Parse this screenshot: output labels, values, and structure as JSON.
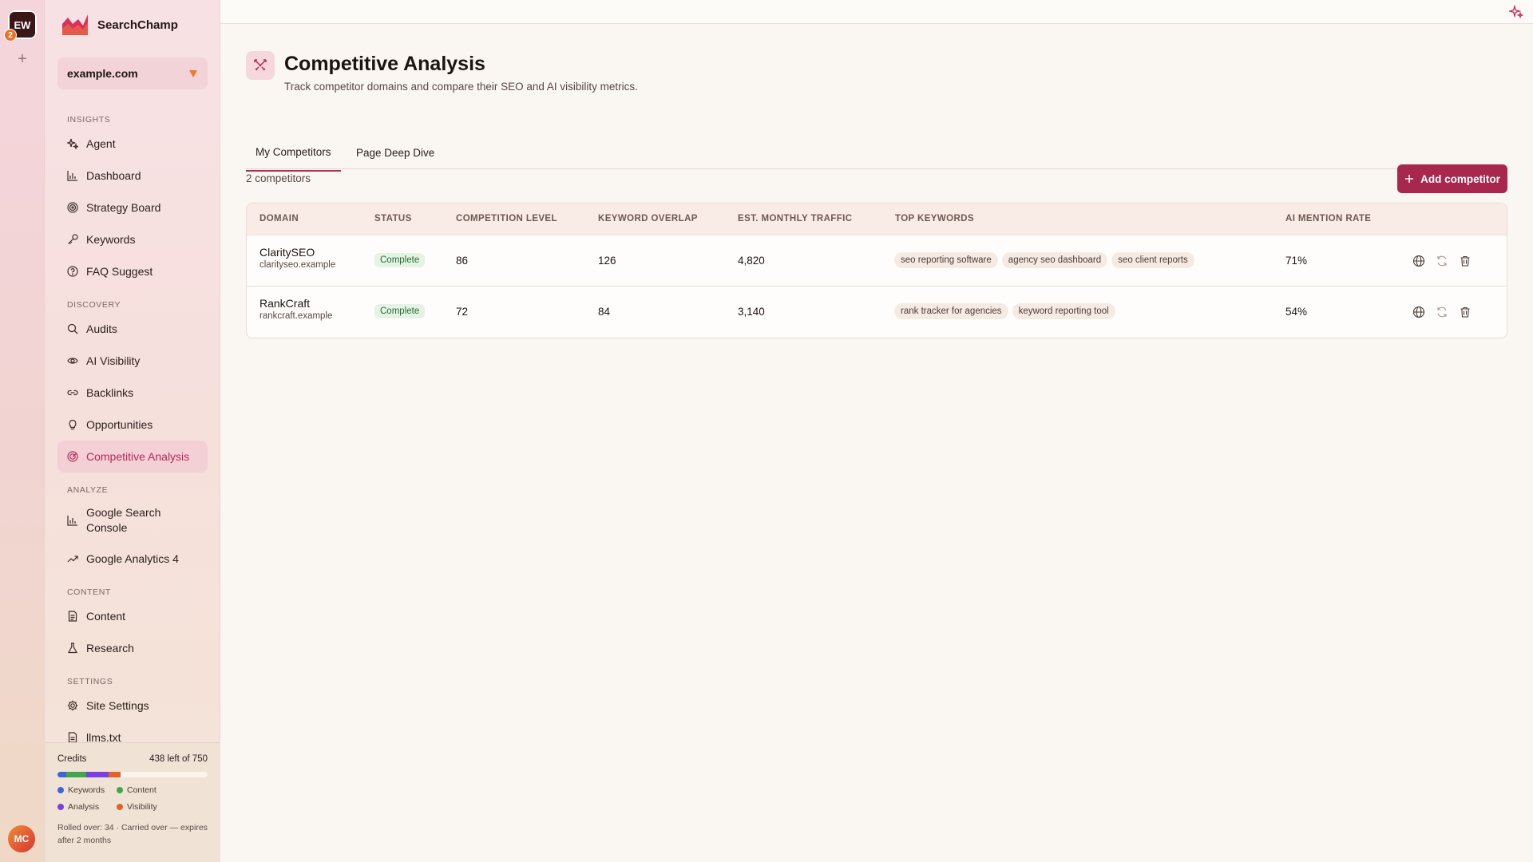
{
  "rail": {
    "workspace_initials": "EW",
    "workspace_count": "2",
    "add_symbol": "+",
    "user_initials": "MC"
  },
  "sidebar": {
    "brand": "SearchChamp",
    "site": "example.com",
    "sections": {
      "insights": "INSIGHTS",
      "discovery": "DISCOVERY",
      "analyze": "ANALYZE",
      "content": "CONTENT",
      "settings": "SETTINGS"
    },
    "items": {
      "agent": "Agent",
      "dashboard": "Dashboard",
      "strategy": "Strategy Board",
      "keywords": "Keywords",
      "faq": "FAQ Suggest",
      "audits": "Audits",
      "ai_visibility": "AI Visibility",
      "backlinks": "Backlinks",
      "opportunities": "Opportunities",
      "competitive": "Competitive Analysis",
      "gsc": "Google Search Console",
      "ga4": "Google Analytics 4",
      "content": "Content",
      "research": "Research",
      "site_settings": "Site Settings",
      "llms": "llms.txt"
    },
    "credits": {
      "label": "Credits",
      "remaining": "438 left of 750",
      "used_fraction": 0.416,
      "segments": [
        {
          "name": "Keywords",
          "color": "#3a66d8",
          "fraction": 0.06
        },
        {
          "name": "Content",
          "color": "#3fa64b",
          "fraction": 0.13
        },
        {
          "name": "Analysis",
          "color": "#7a3fe0",
          "fraction": 0.15
        },
        {
          "name": "Visibility",
          "color": "#e0632b",
          "fraction": 0.08
        }
      ],
      "legend": {
        "keywords": "Keywords",
        "content": "Content",
        "analysis": "Analysis",
        "visibility": "Visibility"
      },
      "rollover": "Rolled over: 34 · Carried over — expires after 2 months"
    }
  },
  "page": {
    "title": "Competitive Analysis",
    "subtitle": "Track competitor domains and compare their SEO and AI visibility metrics.",
    "tabs": [
      "My Competitors",
      "Page Deep Dive"
    ],
    "count": "2 competitors",
    "add_button": "Add competitor"
  },
  "table": {
    "headers": {
      "domain": "DOMAIN",
      "status": "STATUS",
      "level": "COMPETITION LEVEL",
      "overlap": "KEYWORD OVERLAP",
      "traffic": "EST. MONTHLY TRAFFIC",
      "keywords": "TOP KEYWORDS",
      "ai": "AI MENTION RATE"
    },
    "rows": [
      {
        "name": "ClaritySEO",
        "domain": "clarityseo.example",
        "status": "Complete",
        "level": "86",
        "overlap": "126",
        "traffic": "4,820",
        "keywords": [
          "seo reporting software",
          "agency seo dashboard",
          "seo client reports"
        ],
        "ai": "71%"
      },
      {
        "name": "RankCraft",
        "domain": "rankcraft.example",
        "status": "Complete",
        "level": "72",
        "overlap": "84",
        "traffic": "3,140",
        "keywords": [
          "rank tracker for agencies",
          "keyword reporting tool"
        ],
        "ai": "54%"
      }
    ]
  },
  "colors": {
    "accent": "#b52a5b",
    "button": "#a8274f",
    "status_bg": "#e5f3e5"
  }
}
